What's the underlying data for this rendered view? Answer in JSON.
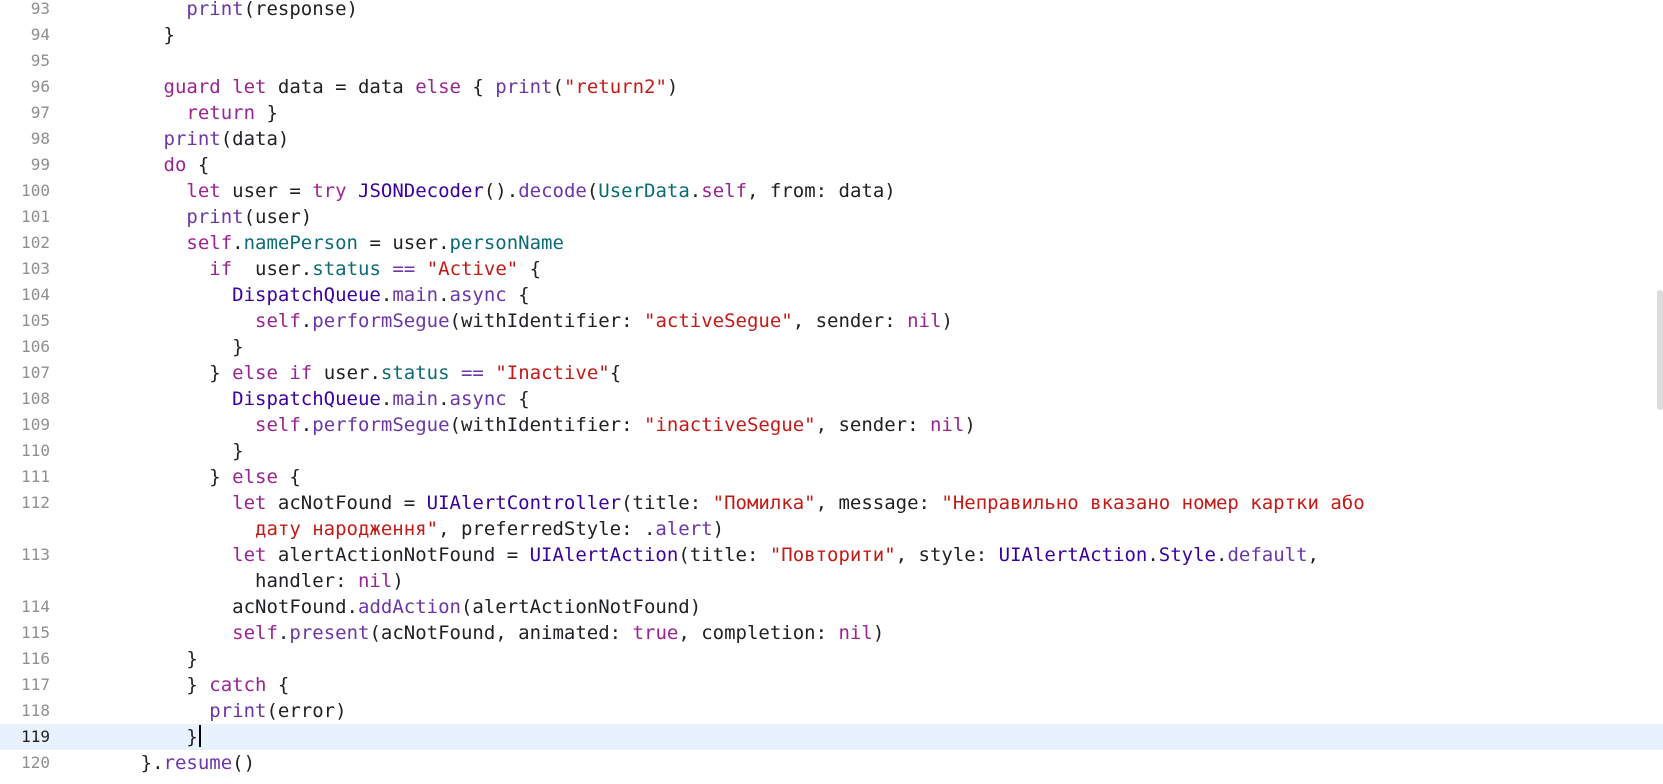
{
  "editor": {
    "language": "Swift",
    "current_line": 119,
    "colors": {
      "background": "#ffffff",
      "current_line": "#e8f2fe",
      "keyword": "#9b2393",
      "string": "#c41a16",
      "type": "#3900a0",
      "method": "#6c36a9",
      "property": "#0b6b74",
      "line_number": "#8f8f8f"
    },
    "lines": [
      {
        "num": "93",
        "indent": 10,
        "tokens": [
          [
            "method",
            "print"
          ],
          [
            "plain",
            "(response)"
          ]
        ]
      },
      {
        "num": "94",
        "indent": 8,
        "tokens": [
          [
            "plain",
            "}"
          ]
        ]
      },
      {
        "num": "95",
        "indent": 0,
        "tokens": []
      },
      {
        "num": "96",
        "indent": 8,
        "tokens": [
          [
            "keyword",
            "guard let"
          ],
          [
            "plain",
            " data = data "
          ],
          [
            "keyword",
            "else"
          ],
          [
            "plain",
            " { "
          ],
          [
            "method",
            "print"
          ],
          [
            "plain",
            "("
          ],
          [
            "string",
            "\"return2\""
          ],
          [
            "plain",
            ")"
          ]
        ]
      },
      {
        "num": "97",
        "indent": 10,
        "tokens": [
          [
            "keyword",
            "return"
          ],
          [
            "plain",
            " }"
          ]
        ]
      },
      {
        "num": "98",
        "indent": 8,
        "tokens": [
          [
            "method",
            "print"
          ],
          [
            "plain",
            "(data)"
          ]
        ]
      },
      {
        "num": "99",
        "indent": 8,
        "tokens": [
          [
            "keyword",
            "do"
          ],
          [
            "plain",
            " {"
          ]
        ]
      },
      {
        "num": "100",
        "indent": 10,
        "tokens": [
          [
            "keyword",
            "let"
          ],
          [
            "plain",
            " user = "
          ],
          [
            "keyword",
            "try"
          ],
          [
            "plain",
            " "
          ],
          [
            "type",
            "JSONDecoder"
          ],
          [
            "plain",
            "()."
          ],
          [
            "method",
            "decode"
          ],
          [
            "plain",
            "("
          ],
          [
            "prop",
            "UserData"
          ],
          [
            "plain",
            "."
          ],
          [
            "keyword",
            "self"
          ],
          [
            "plain",
            ", from: data)"
          ]
        ]
      },
      {
        "num": "101",
        "indent": 10,
        "tokens": [
          [
            "method",
            "print"
          ],
          [
            "plain",
            "(user)"
          ]
        ]
      },
      {
        "num": "102",
        "indent": 10,
        "tokens": [
          [
            "keyword",
            "self"
          ],
          [
            "plain",
            "."
          ],
          [
            "prop",
            "namePerson"
          ],
          [
            "plain",
            " = user."
          ],
          [
            "prop",
            "personName"
          ]
        ]
      },
      {
        "num": "103",
        "indent": 12,
        "tokens": [
          [
            "keyword",
            "if"
          ],
          [
            "plain",
            "  user."
          ],
          [
            "prop",
            "status"
          ],
          [
            "plain",
            " "
          ],
          [
            "method",
            "=="
          ],
          [
            "plain",
            " "
          ],
          [
            "string",
            "\"Active\""
          ],
          [
            "plain",
            " {"
          ]
        ]
      },
      {
        "num": "104",
        "indent": 14,
        "tokens": [
          [
            "type",
            "DispatchQueue"
          ],
          [
            "plain",
            "."
          ],
          [
            "method",
            "main"
          ],
          [
            "plain",
            "."
          ],
          [
            "method",
            "async"
          ],
          [
            "plain",
            " {"
          ]
        ]
      },
      {
        "num": "105",
        "indent": 16,
        "tokens": [
          [
            "keyword",
            "self"
          ],
          [
            "plain",
            "."
          ],
          [
            "method",
            "performSegue"
          ],
          [
            "plain",
            "(withIdentifier: "
          ],
          [
            "string",
            "\"activeSegue\""
          ],
          [
            "plain",
            ", sender: "
          ],
          [
            "keyword",
            "nil"
          ],
          [
            "plain",
            ")"
          ]
        ]
      },
      {
        "num": "106",
        "indent": 14,
        "tokens": [
          [
            "plain",
            "}"
          ]
        ]
      },
      {
        "num": "107",
        "indent": 12,
        "tokens": [
          [
            "plain",
            "} "
          ],
          [
            "keyword",
            "else if"
          ],
          [
            "plain",
            " user."
          ],
          [
            "prop",
            "status"
          ],
          [
            "plain",
            " "
          ],
          [
            "method",
            "=="
          ],
          [
            "plain",
            " "
          ],
          [
            "string",
            "\"Inactive\""
          ],
          [
            "plain",
            "{"
          ]
        ]
      },
      {
        "num": "108",
        "indent": 14,
        "tokens": [
          [
            "type",
            "DispatchQueue"
          ],
          [
            "plain",
            "."
          ],
          [
            "method",
            "main"
          ],
          [
            "plain",
            "."
          ],
          [
            "method",
            "async"
          ],
          [
            "plain",
            " {"
          ]
        ]
      },
      {
        "num": "109",
        "indent": 16,
        "tokens": [
          [
            "keyword",
            "self"
          ],
          [
            "plain",
            "."
          ],
          [
            "method",
            "performSegue"
          ],
          [
            "plain",
            "(withIdentifier: "
          ],
          [
            "string",
            "\"inactiveSegue\""
          ],
          [
            "plain",
            ", sender: "
          ],
          [
            "keyword",
            "nil"
          ],
          [
            "plain",
            ")"
          ]
        ]
      },
      {
        "num": "110",
        "indent": 14,
        "tokens": [
          [
            "plain",
            "}"
          ]
        ]
      },
      {
        "num": "111",
        "indent": 12,
        "tokens": [
          [
            "plain",
            "} "
          ],
          [
            "keyword",
            "else"
          ],
          [
            "plain",
            " {"
          ]
        ]
      },
      {
        "num": "112",
        "indent": 14,
        "wrap_indent": 16,
        "tokens": [
          [
            "keyword",
            "let"
          ],
          [
            "plain",
            " acNotFound = "
          ],
          [
            "type",
            "UIAlertController"
          ],
          [
            "plain",
            "(title: "
          ],
          [
            "string",
            "\"Помилка\""
          ],
          [
            "plain",
            ", message: "
          ],
          [
            "string",
            "\"Неправильно вказано номер картки або"
          ]
        ],
        "cont_tokens": [
          [
            "string",
            "дату народження\""
          ],
          [
            "plain",
            ", preferredStyle: ."
          ],
          [
            "method",
            "alert"
          ],
          [
            "plain",
            ")"
          ]
        ]
      },
      {
        "num": "113",
        "indent": 14,
        "wrap_indent": 16,
        "tokens": [
          [
            "keyword",
            "let"
          ],
          [
            "plain",
            " alertActionNotFound = "
          ],
          [
            "type",
            "UIAlertAction"
          ],
          [
            "plain",
            "(title: "
          ],
          [
            "string",
            "\"Повторити\""
          ],
          [
            "plain",
            ", style: "
          ],
          [
            "type",
            "UIAlertAction"
          ],
          [
            "plain",
            "."
          ],
          [
            "type",
            "Style"
          ],
          [
            "plain",
            "."
          ],
          [
            "method",
            "default"
          ],
          [
            "plain",
            ","
          ]
        ],
        "cont_tokens": [
          [
            "plain",
            "handler: "
          ],
          [
            "keyword",
            "nil"
          ],
          [
            "plain",
            ")"
          ]
        ]
      },
      {
        "num": "114",
        "indent": 14,
        "tokens": [
          [
            "plain",
            "acNotFound."
          ],
          [
            "method",
            "addAction"
          ],
          [
            "plain",
            "(alertActionNotFound)"
          ]
        ]
      },
      {
        "num": "115",
        "indent": 14,
        "tokens": [
          [
            "keyword",
            "self"
          ],
          [
            "plain",
            "."
          ],
          [
            "method",
            "present"
          ],
          [
            "plain",
            "(acNotFound, animated: "
          ],
          [
            "keyword",
            "true"
          ],
          [
            "plain",
            ", completion: "
          ],
          [
            "keyword",
            "nil"
          ],
          [
            "plain",
            ")"
          ]
        ]
      },
      {
        "num": "116",
        "indent": 10,
        "tokens": [
          [
            "plain",
            "}"
          ]
        ]
      },
      {
        "num": "117",
        "indent": 10,
        "tokens": [
          [
            "plain",
            "} "
          ],
          [
            "keyword",
            "catch"
          ],
          [
            "plain",
            " {"
          ]
        ]
      },
      {
        "num": "118",
        "indent": 12,
        "tokens": [
          [
            "method",
            "print"
          ],
          [
            "plain",
            "(error)"
          ]
        ]
      },
      {
        "num": "119",
        "indent": 10,
        "tokens": [
          [
            "plain",
            "}"
          ]
        ],
        "cursor": true
      },
      {
        "num": "120",
        "indent": 6,
        "tokens": [
          [
            "plain",
            "}."
          ],
          [
            "method",
            "resume"
          ],
          [
            "plain",
            "()"
          ]
        ]
      }
    ]
  }
}
